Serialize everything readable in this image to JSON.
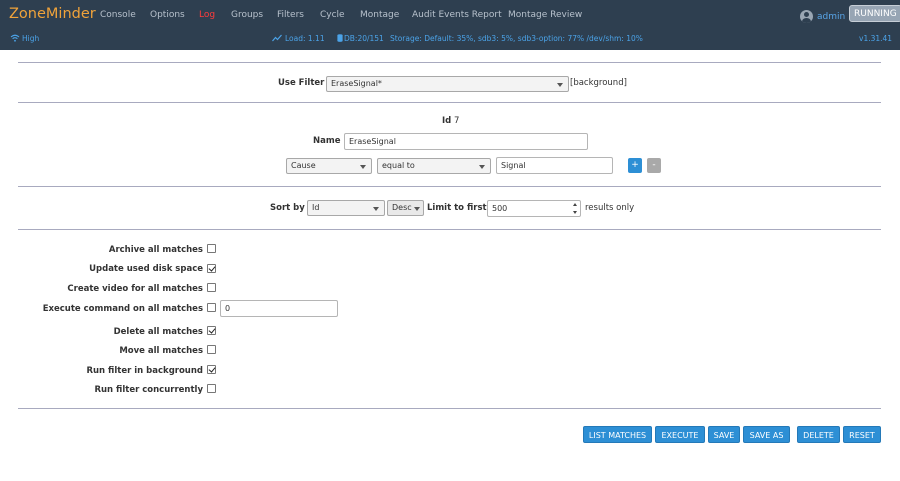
{
  "app": {
    "brand": "ZoneMinder",
    "version": "v1.31.41",
    "state": "RUNNING",
    "user": "admin"
  },
  "nav": {
    "items": [
      {
        "label": "Console"
      },
      {
        "label": "Options"
      },
      {
        "label": "Log",
        "active": true
      },
      {
        "label": "Groups"
      },
      {
        "label": "Filters"
      },
      {
        "label": "Cycle"
      },
      {
        "label": "Montage"
      },
      {
        "label": "Audit Events Report"
      },
      {
        "label": "Montage Review"
      }
    ]
  },
  "status": {
    "bandwidth": "High",
    "load": "Load: 1.11",
    "db": "DB:20/151",
    "storage": "Storage: Default: 35%, sdb3: 5%, sdb3-option: 77% /dev/shm: 10%"
  },
  "filter": {
    "use_filter_label": "Use Filter",
    "use_filter_value": "EraseSignal*",
    "background_note": "[background]",
    "id_label": "Id",
    "id_value": "7",
    "name_label": "Name",
    "name_value": "EraseSignal",
    "term": {
      "attribute": "Cause",
      "operator": "equal to",
      "value": "Signal"
    },
    "add_term": "+",
    "remove_term": "-"
  },
  "sort": {
    "label": "Sort by",
    "field": "Id",
    "direction": "Desc",
    "limit_label": "Limit to first",
    "limit_value": "500",
    "limit_suffix": "results only"
  },
  "options": [
    {
      "label": "Archive all matches",
      "checked": false
    },
    {
      "label": "Update used disk space",
      "checked": true
    },
    {
      "label": "Create video for all matches",
      "checked": false
    },
    {
      "label": "Execute command on all matches",
      "checked": false,
      "command": "0"
    },
    {
      "label": "Delete all matches",
      "checked": true
    },
    {
      "label": "Move all matches",
      "checked": false
    },
    {
      "label": "Run filter in background",
      "checked": true
    },
    {
      "label": "Run filter concurrently",
      "checked": false
    }
  ],
  "actions": {
    "list_matches": "LIST MATCHES",
    "execute": "EXECUTE",
    "save": "SAVE",
    "save_as": "SAVE AS",
    "delete": "DELETE",
    "reset": "RESET"
  },
  "colors": {
    "navbar_bg": "#2e3f50",
    "brand": "#f0a33a",
    "active_nav": "#ff3b3b",
    "status_text": "#4ba3e8",
    "button": "#2d8fd5"
  },
  "icons": {
    "bandwidth": "wifi-icon",
    "load": "chart-line-icon",
    "db": "database-icon",
    "user": "user-circle-icon"
  }
}
